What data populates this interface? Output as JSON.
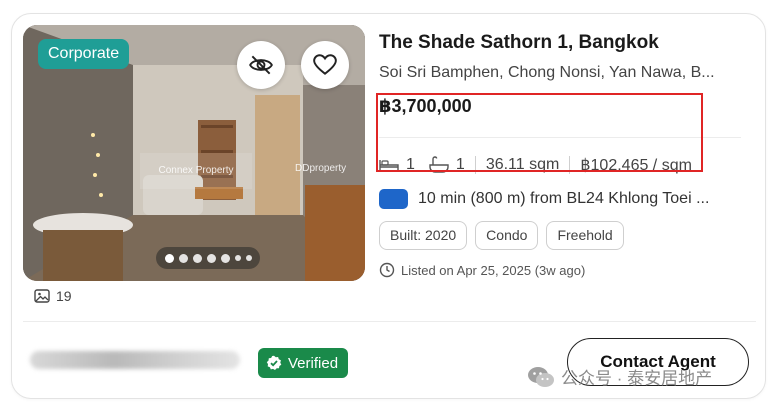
{
  "listing": {
    "badge": "Corporate",
    "photo_count": "19",
    "watermark_left": "Connex Property",
    "watermark_right": "DDproperty",
    "carousel": {
      "total_dots": 7,
      "active_index": 0
    },
    "title": "The Shade Sathorn 1, Bangkok",
    "address": "Soi Sri Bamphen, Chong Nonsi, Yan Nawa, B...",
    "price": "฿3,700,000",
    "specs": {
      "bedrooms": "1",
      "bathrooms": "1",
      "area": "36.11 sqm",
      "price_per_sqm": "฿102,465 / sqm"
    },
    "transit": "10 min (800 m) from BL24 Khlong Toei ...",
    "tags": [
      "Built: 2020",
      "Condo",
      "Freehold"
    ],
    "listed": "Listed on Apr 25, 2025 (3w ago)"
  },
  "agent": {
    "verified_label": "Verified",
    "contact_label": "Contact Agent"
  },
  "overlay": {
    "wechat_label": "公众号 · 泰安居地产"
  },
  "colors": {
    "corporate_badge": "#1f9e96",
    "verified_badge": "#1a8a4a",
    "transit_icon": "#1e66c9",
    "highlight_box": "#e02525"
  },
  "icons": [
    "hide-icon",
    "heart-icon",
    "image-icon",
    "bed-icon",
    "bath-icon",
    "clock-icon",
    "check-badge-icon",
    "wechat-icon"
  ]
}
